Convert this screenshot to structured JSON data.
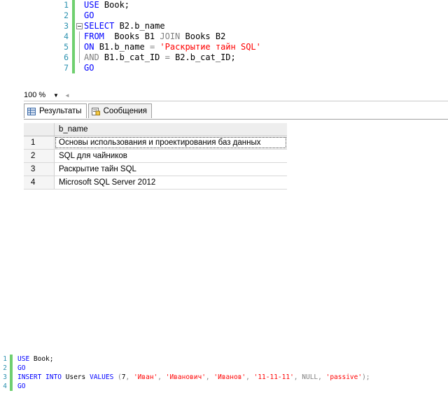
{
  "editor": {
    "lines": [
      {
        "n": "1",
        "parts": [
          {
            "t": "USE ",
            "c": "k"
          },
          {
            "t": "Book;",
            "c": "t"
          }
        ]
      },
      {
        "n": "2",
        "parts": [
          {
            "t": "GO",
            "c": "k"
          }
        ]
      },
      {
        "n": "3",
        "parts": [
          {
            "t": "SELECT ",
            "c": "k"
          },
          {
            "t": "B2.b_name",
            "c": "t"
          }
        ]
      },
      {
        "n": "4",
        "parts": [
          {
            "t": "FROM ",
            "c": "k"
          },
          {
            "t": " Books B1 ",
            "c": "t"
          },
          {
            "t": "JOIN ",
            "c": "g"
          },
          {
            "t": "Books B2",
            "c": "t"
          }
        ]
      },
      {
        "n": "5",
        "parts": [
          {
            "t": "ON ",
            "c": "k"
          },
          {
            "t": "B1.b_name ",
            "c": "t"
          },
          {
            "t": "= ",
            "c": "g"
          },
          {
            "t": "'Раскрытие тайн SQL'",
            "c": "s"
          }
        ]
      },
      {
        "n": "6",
        "parts": [
          {
            "t": "AND ",
            "c": "g"
          },
          {
            "t": "B1.b_cat_ID ",
            "c": "t"
          },
          {
            "t": "= ",
            "c": "g"
          },
          {
            "t": "B2.b_cat_ID;",
            "c": "t"
          }
        ]
      },
      {
        "n": "7",
        "parts": [
          {
            "t": "GO",
            "c": "k"
          }
        ]
      }
    ]
  },
  "zoom": {
    "value": "100 %"
  },
  "tabs": [
    {
      "label": "Результаты",
      "icon": "grid-icon"
    },
    {
      "label": "Сообщения",
      "icon": "messages-icon"
    }
  ],
  "grid": {
    "header": "b_name",
    "rows": [
      {
        "idx": "1",
        "value": "Основы использования и проектирования баз данных"
      },
      {
        "idx": "2",
        "value": "SQL для чайников"
      },
      {
        "idx": "3",
        "value": "Раскрытие тайн SQL"
      },
      {
        "idx": "4",
        "value": "Microsoft SQL Server 2012"
      }
    ]
  },
  "editor2": {
    "lines": [
      {
        "n": "1",
        "parts": [
          {
            "t": "USE ",
            "c": "k"
          },
          {
            "t": "Book;",
            "c": "t"
          }
        ]
      },
      {
        "n": "2",
        "parts": [
          {
            "t": "GO",
            "c": "k"
          }
        ]
      },
      {
        "n": "3",
        "parts": [
          {
            "t": "INSERT INTO ",
            "c": "k"
          },
          {
            "t": "Users ",
            "c": "t"
          },
          {
            "t": "VALUES ",
            "c": "k"
          },
          {
            "t": "(",
            "c": "g"
          },
          {
            "t": "7",
            "c": "t"
          },
          {
            "t": ", ",
            "c": "g"
          },
          {
            "t": "'Иван'",
            "c": "s"
          },
          {
            "t": ", ",
            "c": "g"
          },
          {
            "t": "'Иванович'",
            "c": "s"
          },
          {
            "t": ", ",
            "c": "g"
          },
          {
            "t": "'Иванов'",
            "c": "s"
          },
          {
            "t": ", ",
            "c": "g"
          },
          {
            "t": "'11-11-11'",
            "c": "s"
          },
          {
            "t": ", ",
            "c": "g"
          },
          {
            "t": "NULL",
            "c": "g"
          },
          {
            "t": ", ",
            "c": "g"
          },
          {
            "t": "'passive'",
            "c": "s"
          },
          {
            "t": ");",
            "c": "g"
          }
        ]
      },
      {
        "n": "4",
        "parts": [
          {
            "t": "GO",
            "c": "k"
          }
        ]
      }
    ]
  }
}
